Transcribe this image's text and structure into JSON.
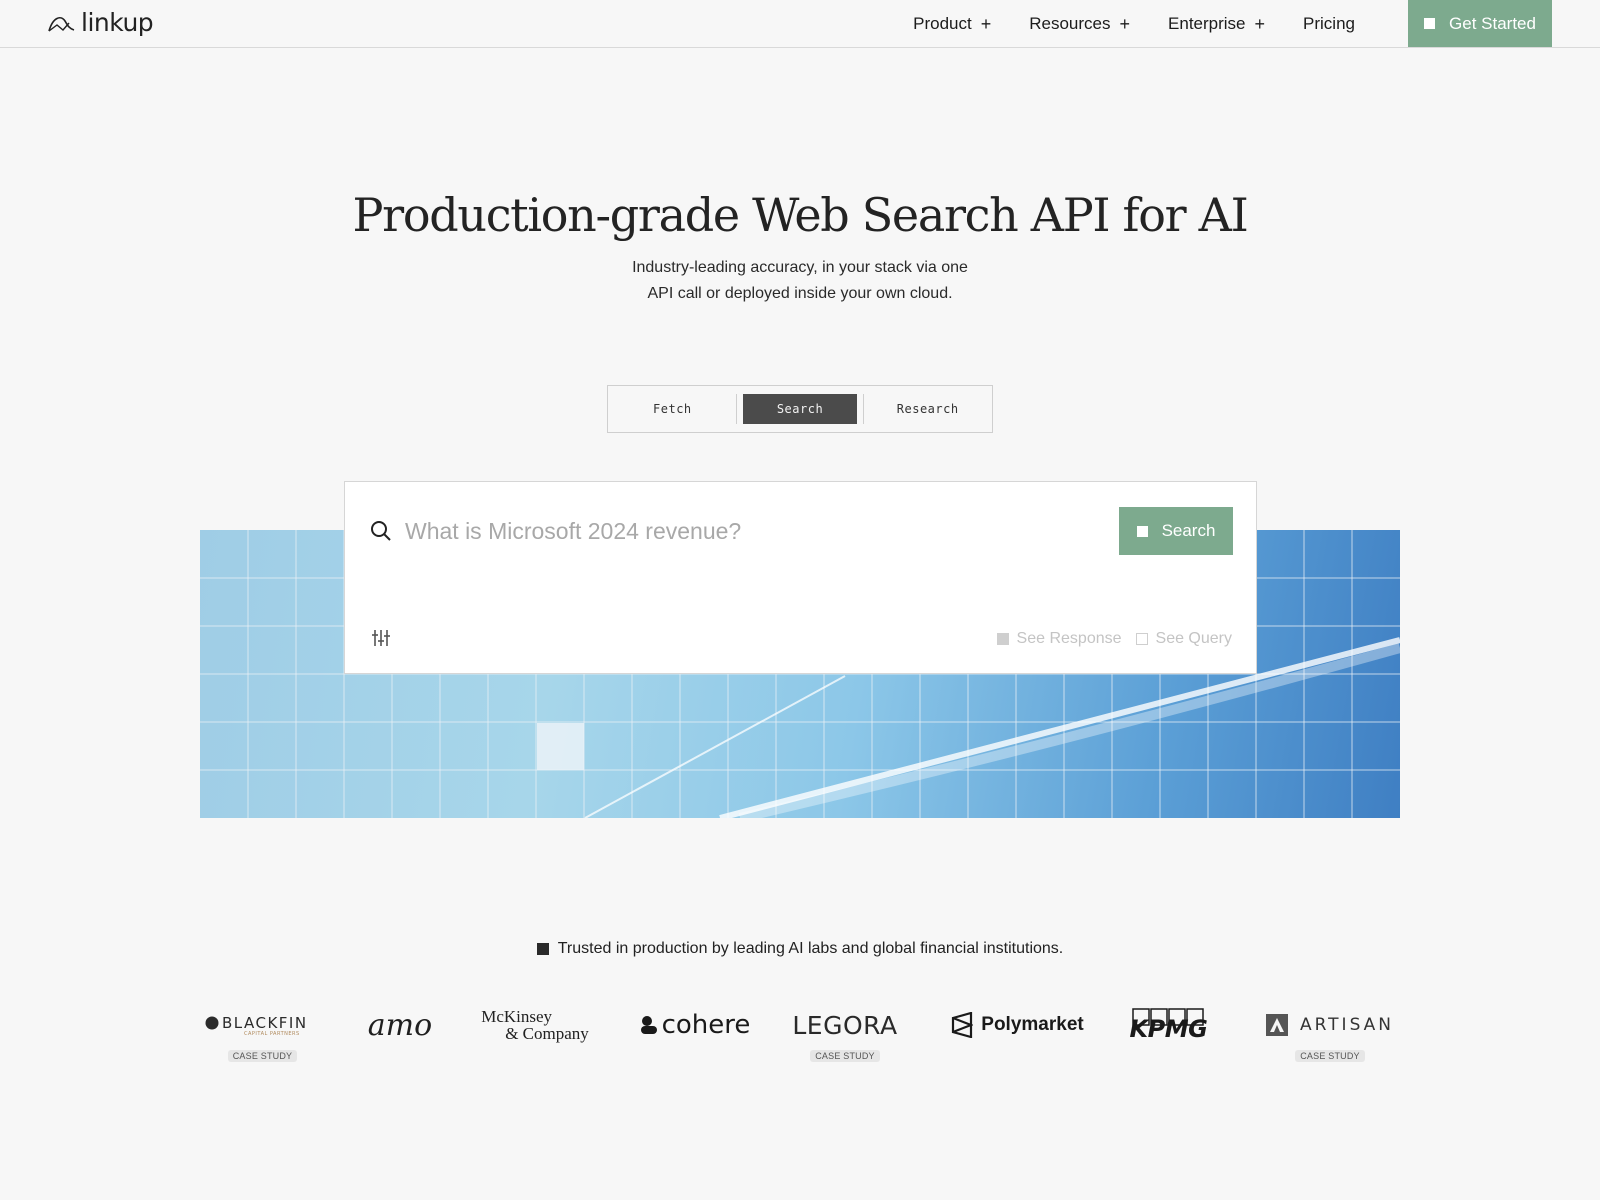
{
  "nav": {
    "logo_text": "linkup",
    "links": [
      {
        "label": "Product",
        "suffix": "+"
      },
      {
        "label": "Resources",
        "suffix": "+"
      },
      {
        "label": "Enterprise",
        "suffix": "+"
      },
      {
        "label": "Pricing",
        "suffix": ""
      }
    ],
    "cta_label": "Get Started"
  },
  "hero": {
    "title": "Production-grade Web Search API for AI",
    "subtitle_line1": "Industry-leading accuracy, in your stack via one",
    "subtitle_line2": "API call or deployed inside your own cloud."
  },
  "tabs": [
    {
      "label": "Fetch",
      "active": false
    },
    {
      "label": "Search",
      "active": true
    },
    {
      "label": "Research",
      "active": false
    }
  ],
  "search": {
    "placeholder": "What is Microsoft 2024 revenue?",
    "button_label": "Search",
    "see_response": "See Response",
    "see_query": "See Query"
  },
  "trusted_text": "Trusted in production by leading AI labs and global financial institutions.",
  "logos": [
    {
      "name": "BLACKFIN",
      "sub": "CAPITAL PARTNERS",
      "case_study": "CASE STUDY"
    },
    {
      "name": "amo",
      "case_study": ""
    },
    {
      "name": "McKinsey",
      "name2": "& Company",
      "case_study": ""
    },
    {
      "name": "cohere",
      "case_study": ""
    },
    {
      "name": "LEGORA",
      "case_study": "CASE STUDY"
    },
    {
      "name": "Polymarket",
      "case_study": ""
    },
    {
      "name": "KPMG",
      "case_study": ""
    },
    {
      "name": "ARTISAN",
      "case_study": "CASE STUDY"
    }
  ],
  "colors": {
    "accent": "#7daa8e",
    "tab_active": "#4b4b4b",
    "background": "#f7f7f7"
  }
}
